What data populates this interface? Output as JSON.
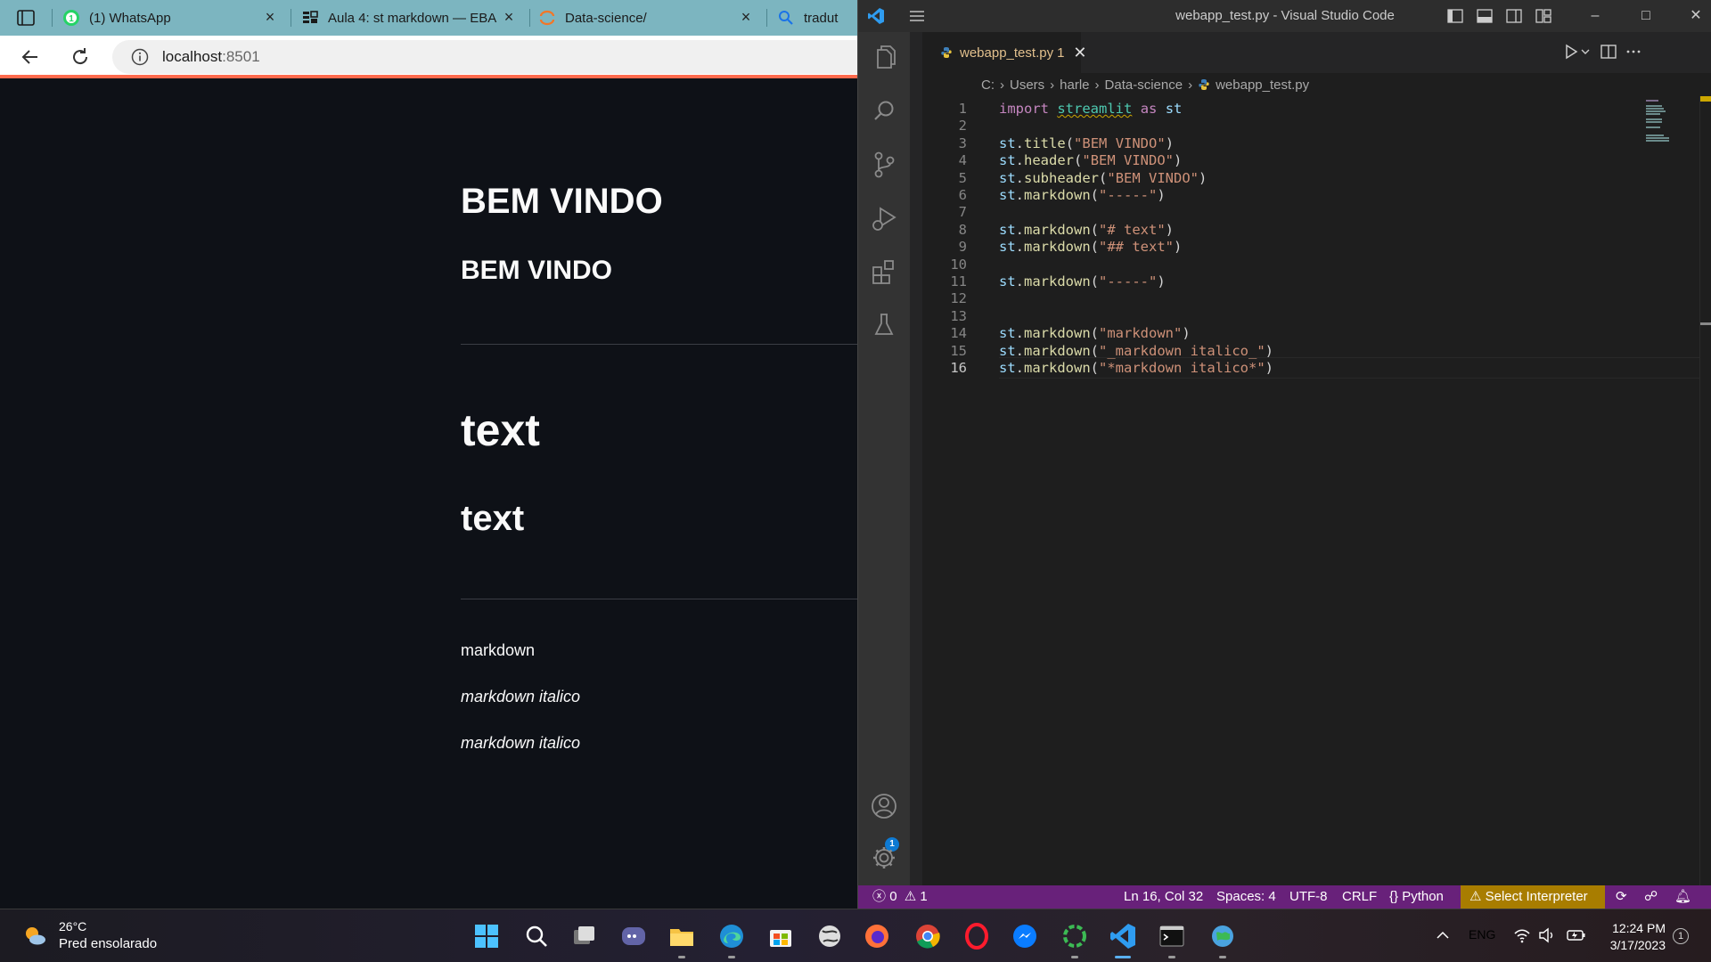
{
  "browser": {
    "tabs": [
      {
        "title": "(1) WhatsApp",
        "icon": "whatsapp-icon"
      },
      {
        "title": "Aula 4: st markdown — EBA",
        "icon": "ebac-icon"
      },
      {
        "title": "Data-science/",
        "icon": "jupyter-icon"
      },
      {
        "title": "tradut",
        "icon": "search-icon"
      }
    ],
    "address": {
      "host": "localhost",
      "port": ":8501"
    }
  },
  "streamlit": {
    "title": "BEM VINDO",
    "header": "BEM VINDO",
    "h1": "text",
    "h2": "text",
    "p1": "markdown",
    "p2": "markdown italico",
    "p3": "markdown italico"
  },
  "vscode": {
    "window_title": "webapp_test.py - Visual Studio Code",
    "tab": {
      "filename": "webapp_test.py",
      "problems": "1"
    },
    "breadcrumb": [
      "C:",
      "Users",
      "harle",
      "Data-science",
      "webapp_test.py"
    ],
    "accounts_badge": "1",
    "code_lines": [
      {
        "n": "1",
        "text": "import streamlit as st"
      },
      {
        "n": "2",
        "text": ""
      },
      {
        "n": "3",
        "text": "st.title(\"BEM VINDO\")"
      },
      {
        "n": "4",
        "text": "st.header(\"BEM VINDO\")"
      },
      {
        "n": "5",
        "text": "st.subheader(\"BEM VINDO\")"
      },
      {
        "n": "6",
        "text": "st.markdown(\"-----\")"
      },
      {
        "n": "7",
        "text": ""
      },
      {
        "n": "8",
        "text": "st.markdown(\"# text\")"
      },
      {
        "n": "9",
        "text": "st.markdown(\"## text\")"
      },
      {
        "n": "10",
        "text": ""
      },
      {
        "n": "11",
        "text": "st.markdown(\"-----\")"
      },
      {
        "n": "12",
        "text": ""
      },
      {
        "n": "13",
        "text": ""
      },
      {
        "n": "14",
        "text": "st.markdown(\"markdown\")"
      },
      {
        "n": "15",
        "text": "st.markdown(\"_markdown italico_\")"
      },
      {
        "n": "16",
        "text": "st.markdown(\"*markdown italico*\")"
      }
    ],
    "status": {
      "errors": "0",
      "warnings": "1",
      "position": "Ln 16, Col 32",
      "spaces": "Spaces: 4",
      "encoding": "UTF-8",
      "eol": "CRLF",
      "language": "Python",
      "interpreter": "Select Interpreter"
    },
    "colors": {
      "statusbar": "#68217a",
      "accent": "#0e7ad3",
      "interpreter": "#a87d00"
    }
  },
  "taskbar": {
    "weather": {
      "temp": "26°C",
      "condition": "Pred ensolarado"
    },
    "apps": [
      "windows-start-icon",
      "search-icon",
      "task-view-icon",
      "chat-icon",
      "file-explorer-icon",
      "edge-icon",
      "store-icon",
      "globe-app-icon",
      "firefox-icon",
      "chrome-icon",
      "opera-icon",
      "messenger-icon",
      "circle-app-icon",
      "vscode-icon",
      "terminal-icon",
      "earth-app-icon"
    ],
    "language": "ENG",
    "time": "12:24 PM",
    "date": "3/17/2023",
    "notifications": "1"
  }
}
